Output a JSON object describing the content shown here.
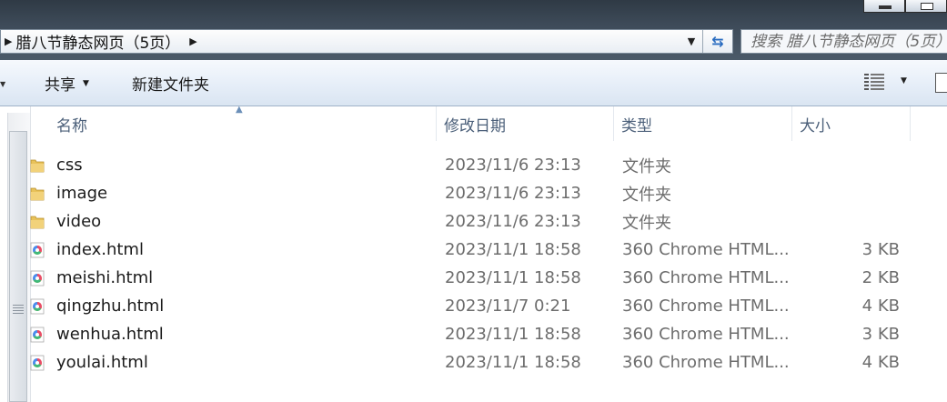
{
  "address_bar": {
    "breadcrumb": "腊八节静态网页（5页）"
  },
  "search": {
    "placeholder": "搜索 腊八节静态网页（5页）"
  },
  "toolbar": {
    "share_label": "共享",
    "new_folder_label": "新建文件夹"
  },
  "columns": {
    "name": "名称",
    "modified": "修改日期",
    "type": "类型",
    "size": "大小"
  },
  "files": [
    {
      "name": "css",
      "modified": "2023/11/6 23:13",
      "type": "文件夹",
      "size": "",
      "icon": "folder-icon"
    },
    {
      "name": "image",
      "modified": "2023/11/6 23:13",
      "type": "文件夹",
      "size": "",
      "icon": "folder-icon"
    },
    {
      "name": "video",
      "modified": "2023/11/6 23:13",
      "type": "文件夹",
      "size": "",
      "icon": "folder-icon"
    },
    {
      "name": "index.html",
      "modified": "2023/11/1 18:58",
      "type": "360 Chrome HTML...",
      "size": "3 KB",
      "icon": "html-file-icon"
    },
    {
      "name": "meishi.html",
      "modified": "2023/11/1 18:58",
      "type": "360 Chrome HTML...",
      "size": "2 KB",
      "icon": "html-file-icon"
    },
    {
      "name": "qingzhu.html",
      "modified": "2023/11/7 0:21",
      "type": "360 Chrome HTML...",
      "size": "4 KB",
      "icon": "html-file-icon"
    },
    {
      "name": "wenhua.html",
      "modified": "2023/11/1 18:58",
      "type": "360 Chrome HTML...",
      "size": "3 KB",
      "icon": "html-file-icon"
    },
    {
      "name": "youlai.html",
      "modified": "2023/11/1 18:58",
      "type": "360 Chrome HTML...",
      "size": "4 KB",
      "icon": "html-file-icon"
    }
  ],
  "colors": {
    "folder": "#e8c25a",
    "header_text": "#4c607a",
    "toolbar_bg": "#e6eef8"
  }
}
